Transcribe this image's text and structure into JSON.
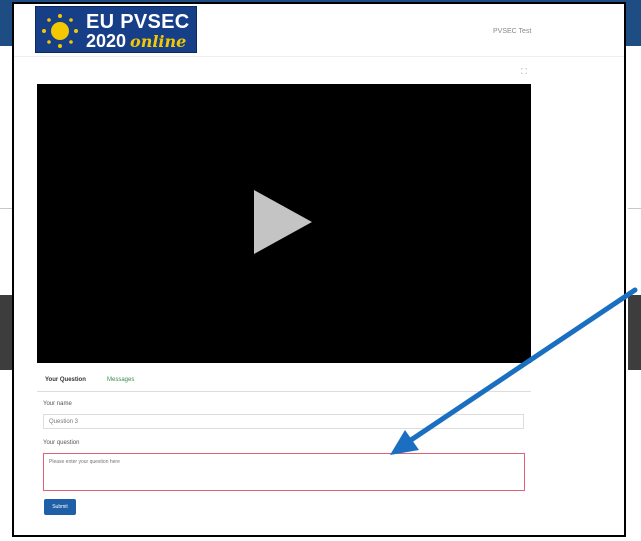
{
  "colors": {
    "brand_blue": "#173f88",
    "logo_yellow": "#f4c800",
    "video_bg": "#000000",
    "submit_blue": "#1e5fa8",
    "arrow_blue": "#1a6fc0",
    "invalid_border": "#e0607a"
  },
  "logo": {
    "line1": "EU PVSEC",
    "line2_year": "2020",
    "line2_word": "online",
    "icon": "sun-icon"
  },
  "header": {
    "user": "PVSEC Test"
  },
  "video": {
    "play_icon": "play-icon",
    "expand_icon": "expand-icon"
  },
  "tabs": [
    {
      "label": "Your Question",
      "active": true
    },
    {
      "label": "Messages",
      "active": false
    }
  ],
  "form": {
    "name_label": "Your name",
    "name_value": "Question 3",
    "question_label": "Your question",
    "question_placeholder": "Please enter your question here",
    "submit_label": "Submit"
  },
  "annotation": {
    "icon": "arrow-icon"
  }
}
